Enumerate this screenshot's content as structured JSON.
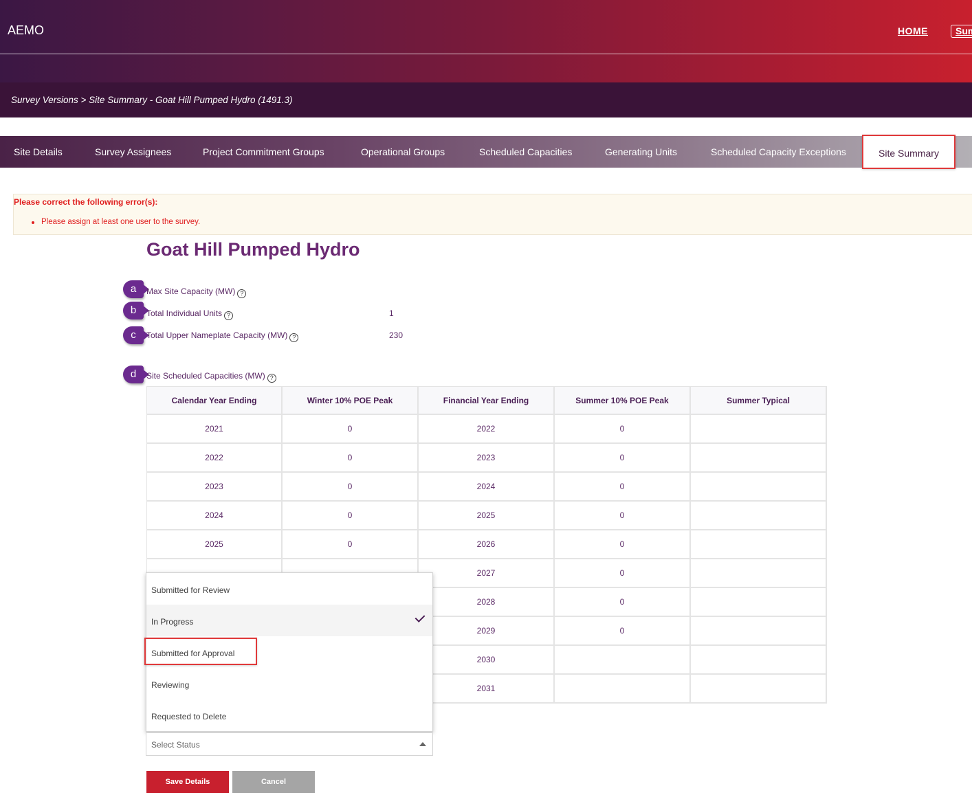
{
  "header": {
    "brand": "AEMO",
    "home_link": "HOME",
    "summary_button": "Sum"
  },
  "breadcrumb": "Survey Versions > Site Summary - Goat Hill Pumped Hydro (1491.3)",
  "tabs": [
    {
      "label": "Site Details"
    },
    {
      "label": "Survey Assignees"
    },
    {
      "label": "Project Commitment Groups"
    },
    {
      "label": "Operational Groups"
    },
    {
      "label": "Scheduled Capacities"
    },
    {
      "label": "Generating Units"
    },
    {
      "label": "Scheduled Capacity Exceptions"
    },
    {
      "label": "Site Summary"
    }
  ],
  "errors": {
    "title": "Please correct the following error(s):",
    "items": [
      "Please assign at least one user to the survey."
    ]
  },
  "page_title": "Goat Hill Pumped Hydro",
  "fields": [
    {
      "marker": "a",
      "label": "Max Site Capacity (MW)",
      "value": ""
    },
    {
      "marker": "b",
      "label": "Total Individual Units",
      "value": "1"
    },
    {
      "marker": "c",
      "label": "Total Upper Nameplate Capacity (MW)",
      "value": "230"
    },
    {
      "marker": "d",
      "label": "Site Scheduled Capacities (MW)",
      "value": ""
    }
  ],
  "help_glyph": "?",
  "table": {
    "headers": [
      "Calendar Year Ending",
      "Winter 10% POE Peak",
      "Financial Year Ending",
      "Summer 10% POE Peak",
      "Summer Typical"
    ],
    "rows": [
      [
        "2021",
        "0",
        "2022",
        "0",
        ""
      ],
      [
        "2022",
        "0",
        "2023",
        "0",
        ""
      ],
      [
        "2023",
        "0",
        "2024",
        "0",
        ""
      ],
      [
        "2024",
        "0",
        "2025",
        "0",
        ""
      ],
      [
        "2025",
        "0",
        "2026",
        "0",
        ""
      ],
      [
        "",
        "",
        "2027",
        "0",
        ""
      ],
      [
        "",
        "",
        "2028",
        "0",
        ""
      ],
      [
        "",
        "",
        "2029",
        "0",
        ""
      ],
      [
        "",
        "",
        "2030",
        "",
        ""
      ],
      [
        "",
        "",
        "2031",
        "",
        ""
      ]
    ]
  },
  "status_dropdown": {
    "options": [
      {
        "label": "Submitted for Review",
        "selected": false
      },
      {
        "label": "In Progress",
        "selected": true
      },
      {
        "label": "Submitted for Approval",
        "selected": false
      },
      {
        "label": "Reviewing",
        "selected": false
      },
      {
        "label": "Requested to Delete",
        "selected": false
      }
    ],
    "placeholder": "Select Status"
  },
  "buttons": {
    "save": "Save Details",
    "cancel": "Cancel"
  },
  "colors": {
    "brand_red": "#c8202e",
    "brand_purple": "#6b2a73",
    "error_red": "#e02020",
    "highlight_red": "#e0393a"
  }
}
